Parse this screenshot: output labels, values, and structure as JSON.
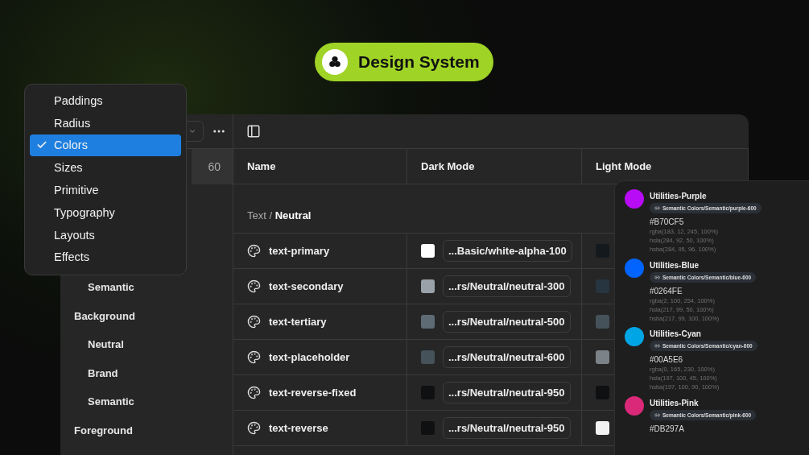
{
  "badge": {
    "label": "Design System"
  },
  "menu": {
    "items": [
      {
        "label": "Paddings",
        "selected": false
      },
      {
        "label": "Radius",
        "selected": false
      },
      {
        "label": "Colors",
        "selected": true
      },
      {
        "label": "Sizes",
        "selected": false
      },
      {
        "label": "Primitive",
        "selected": false
      },
      {
        "label": "Typography",
        "selected": false
      },
      {
        "label": "Layouts",
        "selected": false
      },
      {
        "label": "Effects",
        "selected": false
      }
    ]
  },
  "sidebar": {
    "count": "60",
    "tree": [
      {
        "children": [
          {
            "label": "Semantic"
          }
        ]
      },
      {
        "label": "Background",
        "children": [
          {
            "label": "Neutral"
          },
          {
            "label": "Brand"
          },
          {
            "label": "Semantic"
          }
        ]
      },
      {
        "label": "Foreground"
      }
    ]
  },
  "table": {
    "columns": [
      "Name",
      "Dark Mode",
      "Light Mode"
    ],
    "group": {
      "title": "Text / **Neutral**"
    },
    "rows": [
      {
        "name": "text-primary",
        "dark": {
          "color": "#ffffff",
          "ref": "...Basic/white-alpha-100"
        },
        "light": {
          "color": "#13191c"
        }
      },
      {
        "name": "text-secondary",
        "dark": {
          "color": "#9aa1a8",
          "ref": "...rs/Neutral/neutral-300"
        },
        "light": {
          "color": "#273540"
        }
      },
      {
        "name": "text-tertiary",
        "dark": {
          "color": "#5f6b74",
          "ref": "...rs/Neutral/neutral-500"
        },
        "light": {
          "color": "#46525a"
        }
      },
      {
        "name": "text-placeholder",
        "dark": {
          "color": "#46525a",
          "ref": "...rs/Neutral/neutral-600"
        },
        "light": {
          "color": "#7b8288"
        }
      },
      {
        "name": "text-reverse-fixed",
        "dark": {
          "color": "#0f1012",
          "ref": "...rs/Neutral/neutral-950"
        },
        "light": {
          "color": "#0f1012"
        }
      },
      {
        "name": "text-reverse",
        "dark": {
          "color": "#0f1012",
          "ref": "...rs/Neutral/neutral-950"
        },
        "light": {
          "color": "#f2f2f2"
        }
      }
    ]
  },
  "color_panel": {
    "entries": [
      {
        "name": "Utilities-Purple",
        "color": "#b70cf5",
        "ref": "Semantic Colors/Semantic/purple-600",
        "hex": "#B70CF5",
        "values": [
          "rgba(183, 12, 245, 100%)",
          "hsla(284, 92, 50, 100%)",
          "hsba(284, 95, 96, 100%)"
        ]
      },
      {
        "name": "Utilities-Blue",
        "color": "#0264fe",
        "ref": "Semantic Colors/Semantic/blue-600",
        "hex": "#0264FE",
        "values": [
          "rgba(2, 100, 254, 100%)",
          "hsla(217, 99, 50, 100%)",
          "hsba(217, 99, 100, 100%)"
        ]
      },
      {
        "name": "Utilities-Cyan",
        "color": "#00a5e6",
        "ref": "Semantic Colors/Semantic/cyan-600",
        "hex": "#00A5E6",
        "values": [
          "rgba(0, 165, 230, 100%)",
          "hsla(197, 100, 45, 100%)",
          "hsba(197, 100, 90, 100%)"
        ]
      },
      {
        "name": "Utilities-Pink",
        "color": "#db297a",
        "ref": "Semantic Colors/Semantic/pink-600",
        "hex": "#DB297A"
      }
    ]
  }
}
